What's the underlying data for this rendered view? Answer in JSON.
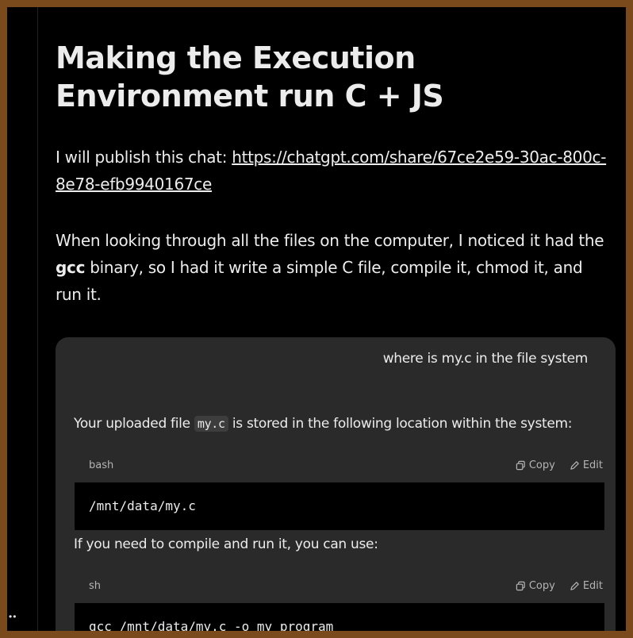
{
  "article": {
    "title": "Making the Execution Environment run C + JS",
    "p1_text": "I will publish this chat: ",
    "p1_link": "https://chatgpt.com/share/67ce2e59-30ac-800c-8e78-efb9940167ce",
    "p2_pre": "When looking through all the files on the computer, I noticed it had the ",
    "p2_bold": "gcc",
    "p2_post": " binary, so I had it write a simple C file, compile it, chmod it, and run it."
  },
  "chat": {
    "user_message": "where is my.c in the file system",
    "reply1_pre": "Your uploaded file ",
    "reply1_code": "my.c",
    "reply1_post": " is stored in the following location within the system:",
    "block1": {
      "lang": "bash",
      "copy": "Copy",
      "edit": "Edit",
      "code": "/mnt/data/my.c"
    },
    "reply2": "If you need to compile and run it, you can use:",
    "block2": {
      "lang": "sh",
      "copy": "Copy",
      "edit": "Edit",
      "code": "gcc /mnt/data/my.c -o my_program"
    }
  },
  "colors": {
    "background": "#000000",
    "frame": "#7a4a1c",
    "card": "#2a2a2a"
  }
}
